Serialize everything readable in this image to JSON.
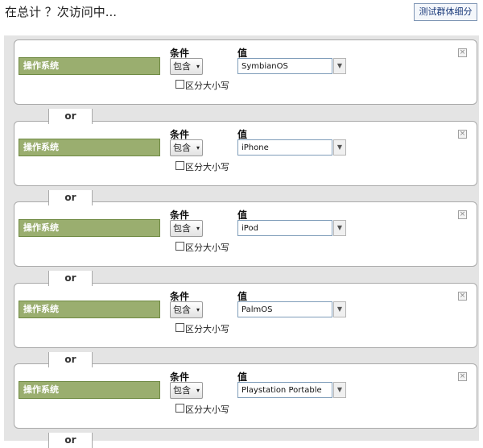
{
  "header": {
    "title": "在总计 ？次访问中...",
    "test_button_label": "测试群体细分"
  },
  "conditions": [
    {
      "dimension": "操作系统",
      "condition_header": "条件",
      "value_header": "值",
      "operator": "包含",
      "value": "SymbianOS",
      "case_label": "区分大小写",
      "case_checked": false
    },
    {
      "dimension": "操作系统",
      "condition_header": "条件",
      "value_header": "值",
      "operator": "包含",
      "value": "iPhone",
      "case_label": "区分大小写",
      "case_checked": false
    },
    {
      "dimension": "操作系统",
      "condition_header": "条件",
      "value_header": "值",
      "operator": "包含",
      "value": "iPod",
      "case_label": "区分大小写",
      "case_checked": false
    },
    {
      "dimension": "操作系统",
      "condition_header": "条件",
      "value_header": "值",
      "operator": "包含",
      "value": "PalmOS",
      "case_label": "区分大小写",
      "case_checked": false
    },
    {
      "dimension": "操作系统",
      "condition_header": "条件",
      "value_header": "值",
      "operator": "包含",
      "value": "Playstation Portable",
      "case_label": "区分大小写",
      "case_checked": false
    }
  ],
  "connectors": [
    "or",
    "or",
    "or",
    "or",
    "or"
  ],
  "icons": {
    "remove": "close-icon",
    "dropdown": "chevron-down-icon"
  },
  "colors": {
    "dimension_bg": "#9aae6f",
    "panel_bg": "#e4e4e4",
    "link_blue": "#1a3a7a"
  }
}
